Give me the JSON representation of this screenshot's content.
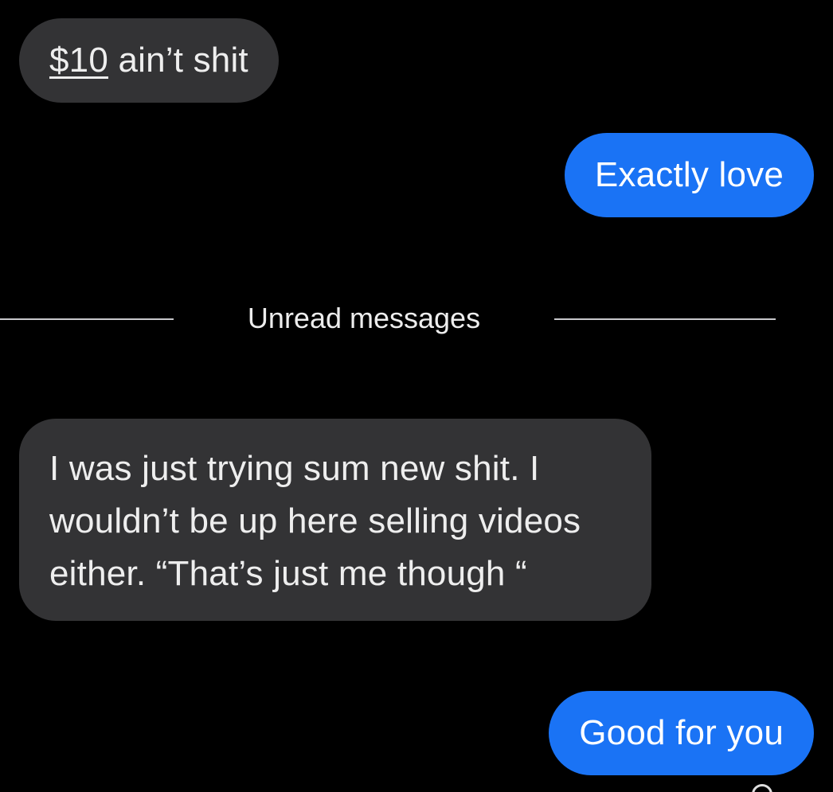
{
  "messages": [
    {
      "direction": "incoming",
      "link_text": "$10",
      "text": " ain’t shit"
    },
    {
      "direction": "outgoing",
      "text": "Exactly love"
    },
    {
      "direction": "incoming",
      "text": "I was just trying sum new shit. I wouldn’t be up here selling videos either. “That’s just me though “"
    },
    {
      "direction": "outgoing",
      "text": "Good for you"
    }
  ],
  "divider": {
    "label": "Unread messages"
  },
  "colors": {
    "background": "#000000",
    "incoming_bubble": "#333335",
    "outgoing_bubble": "#1a73f5"
  }
}
